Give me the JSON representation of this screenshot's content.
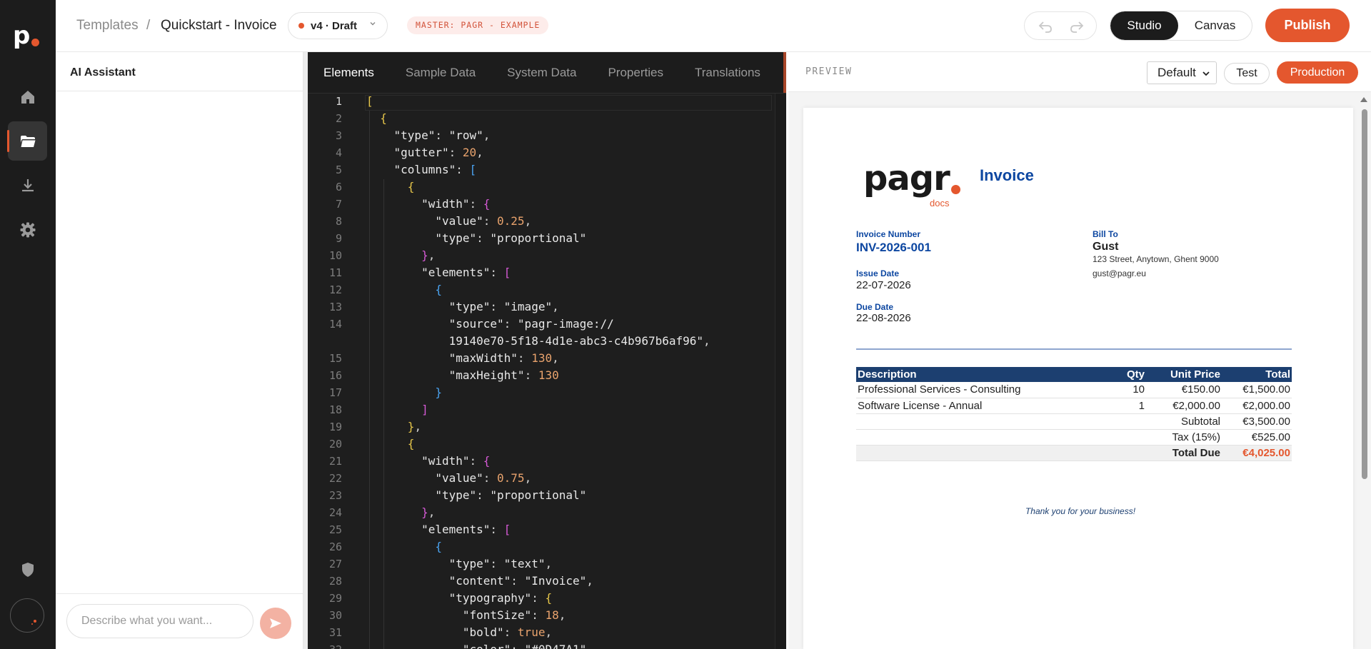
{
  "app": {
    "logo_letter": "p",
    "nav": [
      {
        "icon": "home-icon"
      },
      {
        "icon": "folder-icon",
        "active": true
      },
      {
        "icon": "download-icon"
      },
      {
        "icon": "gear-icon"
      }
    ],
    "bottom_icon": "shield-icon"
  },
  "header": {
    "breadcrumb_root": "Templates",
    "breadcrumb_sep": "/",
    "breadcrumb_current": "Quickstart - Invoice",
    "version_label": "v4 · Draft",
    "master_badge": "MASTER: PAGR - EXAMPLE",
    "mode_studio": "Studio",
    "mode_canvas": "Canvas",
    "publish_label": "Publish"
  },
  "ai_panel": {
    "title": "AI Assistant",
    "input_placeholder": "Describe what you want..."
  },
  "editor": {
    "tabs": [
      "Elements",
      "Sample Data",
      "System Data",
      "Properties",
      "Translations"
    ],
    "active_tab": "Elements",
    "line_numbers": [
      "1",
      "2",
      "3",
      "4",
      "5",
      "6",
      "7",
      "8",
      "9",
      "10",
      "11",
      "12",
      "13",
      "14",
      "15",
      "16",
      "17",
      "18",
      "19",
      "20",
      "21",
      "22",
      "23",
      "24",
      "25",
      "26",
      "27",
      "28",
      "29",
      "30",
      "31",
      "32"
    ]
  },
  "preview": {
    "label": "PREVIEW",
    "select_value": "Default",
    "test_label": "Test",
    "production_label": "Production",
    "invoice": {
      "brand": "pagr",
      "brand_dot": ".",
      "brand_sub": "docs",
      "title": "Invoice",
      "invoice_number_label": "Invoice Number",
      "invoice_number": "INV-2026-001",
      "issue_date_label": "Issue Date",
      "issue_date": "22-07-2026",
      "due_date_label": "Due Date",
      "due_date": "22-08-2026",
      "bill_to_label": "Bill To",
      "bill_to_name": "Gust",
      "bill_to_address": "123 Street, Anytown, Ghent 9000",
      "bill_to_email": "gust@pagr.eu",
      "columns": [
        "Description",
        "Qty",
        "Unit Price",
        "Total"
      ],
      "rows": [
        {
          "description": "Professional Services - Consulting",
          "qty": "10",
          "unit_price": "€150.00",
          "total": "€1,500.00"
        },
        {
          "description": "Software License - Annual",
          "qty": "1",
          "unit_price": "€2,000.00",
          "total": "€2,000.00"
        }
      ],
      "subtotal_label": "Subtotal",
      "subtotal": "€3,500.00",
      "tax_label": "Tax (15%)",
      "tax": "€525.00",
      "total_due_label": "Total Due",
      "total_due": "€4,025.00",
      "thanks": "Thank you for your business!"
    }
  },
  "colors": {
    "accent": "#e4572e",
    "invoice_blue": "#0D47A1",
    "table_header": "#1c3f70",
    "editor_bg": "#1e1e1e"
  }
}
